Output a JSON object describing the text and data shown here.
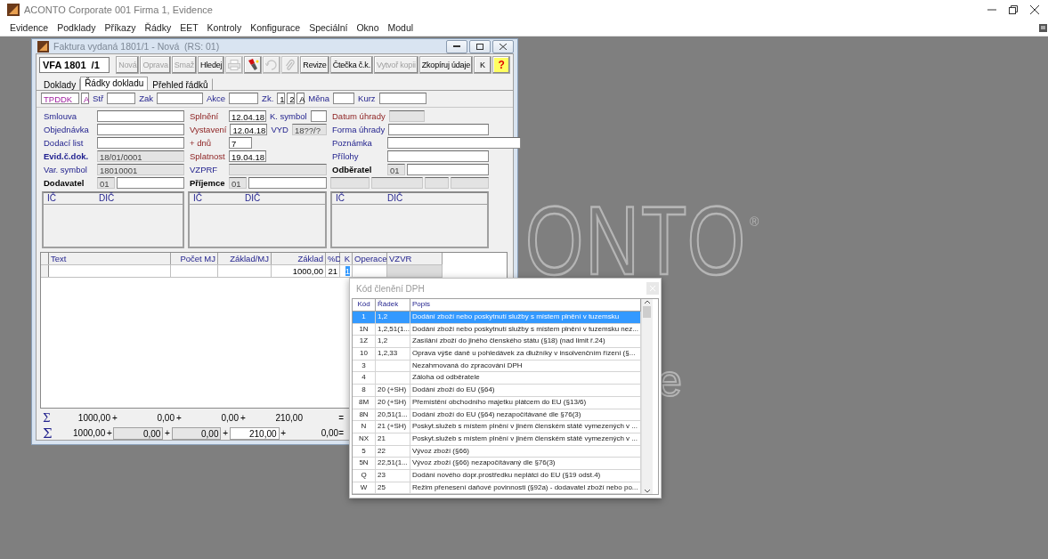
{
  "app": {
    "title": "ACONTO Corporate 001 Firma 1, Evidence",
    "menu": [
      "Evidence",
      "Podklady",
      "Příkazy",
      "Řádky",
      "EET",
      "Kontroly",
      "Konfigurace",
      "Speciální",
      "Okno",
      "Modul"
    ]
  },
  "background_logo": {
    "text": "ONTO",
    "mark": "®",
    "tail": "e"
  },
  "invoice_window": {
    "title": "Faktura vydaná 1801/1 - Nová  (RS: 01)",
    "doc_number": "VFA 1801  /1",
    "toolbar": [
      {
        "kind": "text",
        "label": "Nová",
        "disabled": true
      },
      {
        "kind": "text",
        "label": "Oprava",
        "disabled": true
      },
      {
        "kind": "text",
        "label": "Smaž",
        "disabled": true
      },
      {
        "kind": "text",
        "label": "Hledej",
        "disabled": false
      },
      {
        "kind": "print",
        "disabled": true
      },
      {
        "kind": "flashlight",
        "disabled": false
      },
      {
        "kind": "refresh",
        "disabled": true
      },
      {
        "kind": "clip",
        "disabled": true
      },
      {
        "kind": "text",
        "label": "Revize",
        "disabled": false
      },
      {
        "kind": "text",
        "label": "Čtečka č.k.",
        "disabled": false
      },
      {
        "kind": "text",
        "label": "Vytvoř kopii",
        "disabled": true
      },
      {
        "kind": "text",
        "label": "Zkopíruj údaje",
        "disabled": false
      },
      {
        "kind": "text",
        "label": "K",
        "disabled": false
      },
      {
        "kind": "help",
        "label": "?",
        "disabled": false
      }
    ],
    "tabs": [
      {
        "label": "Doklady",
        "selected": false
      },
      {
        "label": "Řádky dokladu",
        "selected": true
      },
      {
        "label": "Přehled řádků",
        "selected": false
      }
    ],
    "top_row": [
      {
        "kind": "code",
        "value": "TPDDK",
        "readonly": false
      },
      {
        "kind": "code",
        "value": "A",
        "readonly": false
      },
      {
        "kind": "optional",
        "text": "Stř"
      },
      {
        "kind": "field",
        "readonly": false
      },
      {
        "kind": "optional",
        "text": "Zak"
      },
      {
        "kind": "field",
        "readonly": false
      },
      {
        "kind": "optional",
        "text": "Akce"
      },
      {
        "kind": "field",
        "readonly": false
      },
      {
        "kind": "optional",
        "text": "Zk."
      },
      {
        "kind": "field",
        "value": "1",
        "readonly": false
      },
      {
        "kind": "field",
        "value": "2",
        "readonly": false
      },
      {
        "kind": "field",
        "value": "A",
        "readonly": false
      },
      {
        "kind": "optional",
        "text": "Měna"
      },
      {
        "kind": "field",
        "readonly": false
      },
      {
        "kind": "optional",
        "text": "Kurz"
      },
      {
        "kind": "field",
        "readonly": false
      }
    ],
    "form_columns": [
      {
        "rows": [
          [
            {
              "kind": "optional",
              "text": "Smlouva"
            },
            {
              "kind": "field",
              "readonly": false
            }
          ],
          [
            {
              "kind": "optional",
              "text": "Objednávka"
            },
            {
              "kind": "field",
              "readonly": false
            }
          ],
          [
            {
              "kind": "optional",
              "text": "Dodací list"
            },
            {
              "kind": "field",
              "readonly": false
            }
          ],
          [
            {
              "kind": "key",
              "text": "Evid.č.dok."
            },
            {
              "kind": "field",
              "value": "18/01/0001",
              "readonly": true
            }
          ],
          [
            {
              "kind": "optional",
              "text": "Var. symbol"
            },
            {
              "kind": "field",
              "value": "18010001",
              "readonly": true
            }
          ],
          [
            {
              "kind": "party",
              "text": "Dodavatel"
            },
            {
              "kind": "field",
              "value": "01",
              "readonly": true
            },
            {
              "kind": "field",
              "readonly": false
            }
          ]
        ],
        "id_panel": [
          "IČ",
          "DIČ"
        ]
      },
      {
        "rows": [
          [
            {
              "kind": "required",
              "text": "Splnění"
            },
            {
              "kind": "field",
              "value": "12.04.18",
              "readonly": false
            },
            {
              "kind": "optional",
              "text": "K. symbol"
            },
            {
              "kind": "field",
              "readonly": false
            }
          ],
          [
            {
              "kind": "required",
              "text": "Vystavení"
            },
            {
              "kind": "field",
              "value": "12.04.18",
              "readonly": false
            },
            {
              "kind": "optional",
              "text": "VYD"
            },
            {
              "kind": "field",
              "value": "18??/?",
              "readonly": true
            }
          ],
          [
            {
              "kind": "required",
              "text": "+ dnů"
            },
            {
              "kind": "field",
              "value": "7",
              "readonly": false
            }
          ],
          [
            {
              "kind": "required",
              "text": "Splatnost"
            },
            {
              "kind": "field",
              "value": "19.04.18",
              "readonly": false
            }
          ],
          [
            {
              "kind": "optional",
              "text": "VZPRF"
            },
            {
              "kind": "field",
              "readonly": true
            }
          ],
          [
            {
              "kind": "party",
              "text": "Příjemce"
            },
            {
              "kind": "field",
              "value": "01",
              "readonly": true
            },
            {
              "kind": "field",
              "readonly": false
            }
          ]
        ],
        "id_panel": [
          "IČ",
          "DIČ"
        ]
      },
      {
        "rows": [
          [
            {
              "kind": "required",
              "text": "Datum úhrady"
            },
            {
              "kind": "field",
              "readonly": true
            }
          ],
          [
            {
              "kind": "optional",
              "text": "Forma úhrady"
            },
            {
              "kind": "field",
              "readonly": false
            }
          ],
          [
            {
              "kind": "optional",
              "text": "Poznámka"
            },
            {
              "kind": "field",
              "readonly": false
            }
          ],
          [
            {
              "kind": "optional",
              "text": "Přílohy"
            },
            {
              "kind": "field",
              "readonly": false
            }
          ],
          [
            {
              "kind": "party",
              "text": "Odběratel"
            },
            {
              "kind": "field",
              "value": "01",
              "readonly": true
            },
            {
              "kind": "field",
              "readonly": false
            }
          ],
          [
            {
              "kind": "field",
              "readonly": true
            },
            {
              "kind": "field",
              "readonly": true
            },
            {
              "kind": "field",
              "readonly": true
            },
            {
              "kind": "field",
              "readonly": true
            }
          ]
        ],
        "id_panel": [
          "IČ",
          "DIČ"
        ]
      }
    ],
    "table": {
      "columns": [
        "Text",
        "Počet MJ",
        "Základ/MJ",
        "Základ",
        "%D",
        "K",
        "Operace",
        "VZVR"
      ],
      "rows": [
        {
          "cells": [
            {
              "selected": false,
              "readonly": false
            },
            {
              "selected": false,
              "readonly": false
            },
            {
              "selected": false,
              "readonly": false
            },
            {
              "text": "1000,00",
              "selected": false,
              "readonly": false
            },
            {
              "text": "21",
              "selected": false,
              "readonly": false
            },
            {
              "text": "1",
              "selected": true,
              "readonly": false
            },
            {
              "selected": false,
              "readonly": false
            },
            {
              "selected": false,
              "readonly": true
            }
          ]
        }
      ]
    },
    "totals": [
      [
        {
          "kind": "sigma",
          "text": "Σ"
        },
        {
          "kind": "value",
          "text": "1000,00"
        },
        {
          "kind": "op",
          "text": "+"
        },
        {
          "kind": "value",
          "text": "0,00"
        },
        {
          "kind": "op",
          "text": "+"
        },
        {
          "kind": "value",
          "text": "0,00"
        },
        {
          "kind": "op",
          "text": "+"
        },
        {
          "kind": "value",
          "text": "210,00"
        },
        {
          "kind": "result",
          "text": "="
        }
      ],
      [
        {
          "kind": "sigma",
          "text": "Σ"
        },
        {
          "kind": "value",
          "text": "1000,00"
        },
        {
          "kind": "op",
          "text": "+"
        },
        {
          "kind": "field",
          "text": "0,00",
          "readonly": true
        },
        {
          "kind": "op",
          "text": "+"
        },
        {
          "kind": "field",
          "text": "0,00",
          "readonly": true
        },
        {
          "kind": "op",
          "text": "+"
        },
        {
          "kind": "field",
          "text": "210,00",
          "readonly": false
        },
        {
          "kind": "op",
          "text": "+"
        },
        {
          "kind": "value",
          "text": "0,00"
        },
        {
          "kind": "result",
          "text": "="
        }
      ]
    ]
  },
  "popup": {
    "title": "Kód členění DPH",
    "columns": [
      "Kód",
      "Řádek",
      "Popis"
    ],
    "rows": [
      {
        "code": "1",
        "row": "1,2",
        "description": "Dodání zboží nebo poskytnutí služby s místem plnění v tuzemsku",
        "selected": true
      },
      {
        "code": "1N",
        "row": "1,2,51(1...",
        "description": "Dodání zboží nebo poskytnutí služby s místem plnění v tuzemsku nez...",
        "selected": false
      },
      {
        "code": "1Z",
        "row": "1,2",
        "description": "Zasílání zboží do jiného členského státu (§18) (nad limit ř.24)",
        "selected": false
      },
      {
        "code": "10",
        "row": "1,2,33",
        "description": "Oprava výše daně u pohledávek za dlužníky v insolvenčním řízení (§...",
        "selected": false
      },
      {
        "code": "3",
        "description": "Nezahrnovaná do zpracování DPH",
        "selected": false
      },
      {
        "code": "4",
        "description": "Záloha od odběratele",
        "selected": false
      },
      {
        "code": "8",
        "row": "20 (+SH)",
        "description": "Dodání zboží do EU (§64)",
        "selected": false
      },
      {
        "code": "8M",
        "row": "20 (+SH)",
        "description": "Přemístění obchodního majetku plátcem do EU (§13/6)",
        "selected": false
      },
      {
        "code": "8N",
        "row": "20,51(1...",
        "description": "Dodání zboží do EU (§64) nezapočítávané dle §76(3)",
        "selected": false
      },
      {
        "code": "N",
        "row": "21 (+SH)",
        "description": "Poskyt.služeb s místem plnění v jiném členském státě vymezených v ...",
        "selected": false
      },
      {
        "code": "NX",
        "row": "21",
        "description": "Poskyt.služeb s místem plnění v jiném členském státě vymezených v ...",
        "selected": false
      },
      {
        "code": "5",
        "row": "22",
        "description": "Vývoz zboží (§66)",
        "selected": false
      },
      {
        "code": "5N",
        "row": "22,51(1...",
        "description": "Vývoz zboží (§66) nezapočítávaný dle §76(3)",
        "selected": false
      },
      {
        "code": "Q",
        "row": "23",
        "description": "Dodání nového dopr.prostředku neplátci do EU (§19 odst.4)",
        "selected": false
      },
      {
        "code": "W",
        "row": "25",
        "description": "Režim přenesení daňové povinnosti (§92a) - dodavatel zboží nebo po...",
        "selected": false
      }
    ]
  }
}
